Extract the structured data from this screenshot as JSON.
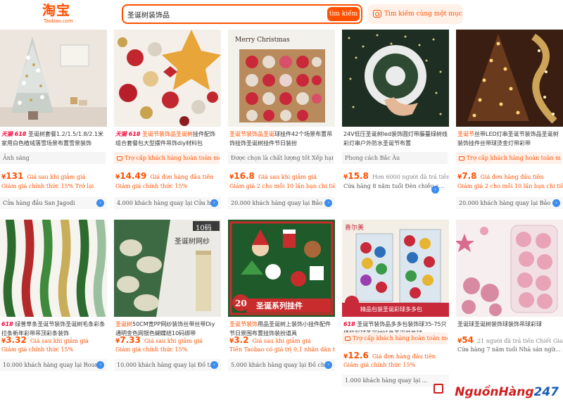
{
  "header": {
    "logo_text": "淘宝",
    "logo_sub": "Taobao.com",
    "search_value": "圣诞树装饰品",
    "search_button": "tìm kiếm",
    "image_search_label": "Tìm kiếm cùng một mục"
  },
  "products": [
    {
      "tag": "天猫 618",
      "title_hl": "",
      "title": "圣诞树套餐1.2/1.5/1.8/2.1米家用白色植绒落雪场景布置雪景装饰",
      "badge": "Ảnh sáng",
      "badge_style": "gray",
      "price": "131",
      "price_note": "Giá sau khi giảm giá",
      "promo": "Giảm giá chính thức 15%  Trở lại",
      "shop": "Cửa hàng đầu San Jagodi"
    },
    {
      "tag": "天猫 618",
      "title_hl": "圣诞节装饰品圣诞树",
      "title": "挂件配饰组合套餐包大型摆件吊饰diy材料包",
      "badge": "Trợ cấp khách hàng hoàn toàn mới",
      "badge_style": "orange",
      "price": "14.49",
      "price_note": "Giá đơn hàng đầu tiên",
      "promo": "Giảm giá chính thức 15%",
      "shop": "4.000 khách hàng quay lại Cửa h..."
    },
    {
      "tag": "",
      "title_hl": "圣诞节装饰品圣诞",
      "title": "球挂件42个场景布置吊饰挂饰圣诞树挂件节日装扮",
      "badge": "Được chọn là chất lượng tốt  Xếp hạng",
      "badge_style": "gray",
      "price": "16.8",
      "price_note": "Giá sau khi giảm giá",
      "promo": "Giảm giá 2 cho mỗi 10 lần bạn chi tiêu",
      "shop": "20.000 khách hàng quay lại Bảo ..."
    },
    {
      "tag": "",
      "title_hl": "",
      "title": "24V低压圣诞树led装饰圆灯带藤蔓绿树线彩灯串户外防水圣诞节布置",
      "badge": "Phong cách Bắc Âu",
      "badge_style": "gray",
      "price": "15.8",
      "price_note": "Hơn 6000 người đã trả tiền",
      "price_note_style": "gray",
      "promo": "Cửa hàng 8 năm tuổi  Đèn chiếu s...",
      "shop": ""
    },
    {
      "tag": "",
      "title_hl": "圣诞节",
      "title": "丝带LED灯串圣诞节装饰品圣诞树装饰挂件丝带球烫金灯带彩带",
      "badge": "Trợ cấp khách hàng hoàn toàn m...",
      "badge_style": "orange",
      "price": "7.8",
      "price_note": "Giá đơn hàng đầu tiên",
      "promo": "Giảm giá 2 cho mỗi 10 lần bạn chi tiêu",
      "shop": "20.000 khách hàng quay lại Bảo ..."
    },
    {
      "tag": "618",
      "title_hl": "",
      "title": "绿普草条圣诞节装饰圣诞树毛条彩条拉条新年彩带吊顶彩条装饰",
      "badge": "",
      "badge_style": "none",
      "price": "3.32",
      "price_note": "Giá sau khi giảm giá",
      "promo": "Giảm giá chính thức 15%",
      "shop": "10.000 khách hàng quay lại Rour..."
    },
    {
      "tag": "",
      "title_hl": "圣诞树",
      "title": "50CM宽PP网纱装饰丝带丝带Diy通明金色网银色蝴蝶结10码绑带",
      "badge": "",
      "badge_style": "none",
      "price": "7.33",
      "price_note": "Giá sau khi giảm giá",
      "promo": "Giảm giá chính thức 15%",
      "shop": "10.000 khách hàng quay lại Đồ t..."
    },
    {
      "tag": "",
      "title_hl": "圣诞节装饰",
      "title": "用品圣诞树上装饰小挂件配件节日景围布置挂饰装扮道具",
      "badge": "",
      "badge_style": "none",
      "price": "3.2",
      "price_note": "Giá sau khi giảm giá",
      "promo": "Tiền Taobao có giá trị 0,1 nhân dân tệ",
      "shop": "5.000 khách hàng quay lại Đồ ch..."
    },
    {
      "tag": "618",
      "title_hl": "",
      "title": "圣诞节装饰品多多包装饰球35-75只桶装彩球圣诞树挂件圣诞装饰球",
      "badge": "Trợ cấp khách hàng hoàn toàn mới",
      "badge_style": "orange",
      "price": "12.6",
      "price_note": "Giá đơn hàng đầu tiên",
      "promo": "Giảm giá chính thức 15%",
      "shop": "1.000 khách hàng quay lại ..."
    },
    {
      "tag": "",
      "title_hl": "",
      "title": "圣诞球圣诞树装饰球装饰吊球彩球",
      "badge": "",
      "badge_style": "none",
      "price": "54",
      "price_note": "21 người đã trả tiền  Chiết Giang",
      "price_note_style": "gray",
      "promo": "Cửa hàng 7 năm tuổi  Nhà sản ngữ...",
      "shop": ""
    }
  ],
  "image_labels": {
    "p3_caption": "Merry Christmas",
    "p7_tag": "10码",
    "p7_title": "圣诞树网纱",
    "p8_banner": "圣诞系列挂件",
    "p8_count": "20",
    "p9_brand": "喜尔美",
    "p9_bottom": "精品包装圣诞彩球多多包"
  },
  "watermark": {
    "red": "NguồnHàng",
    "blue": "247"
  },
  "colors": {
    "accent": "#ff5000",
    "tmall": "#ff0036"
  }
}
